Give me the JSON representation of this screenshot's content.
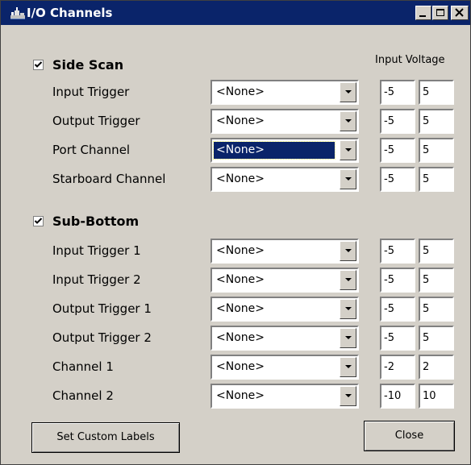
{
  "window": {
    "title": "I/O Channels",
    "controls": {
      "minimize": "minimize",
      "maximize": "maximize",
      "close": "close"
    }
  },
  "header": {
    "voltage_label": "Input Voltage"
  },
  "side_scan": {
    "label": "Side Scan",
    "checked": true,
    "rows": [
      {
        "label": "Input Trigger",
        "select": "<None>",
        "min": "-5",
        "max": "5",
        "selected": false
      },
      {
        "label": "Output Trigger",
        "select": "<None>",
        "min": "-5",
        "max": "5",
        "selected": false
      },
      {
        "label": "Port Channel",
        "select": "<None>",
        "min": "-5",
        "max": "5",
        "selected": true
      },
      {
        "label": "Starboard Channel",
        "select": "<None>",
        "min": "-5",
        "max": "5",
        "selected": false
      }
    ]
  },
  "sub_bottom": {
    "label": "Sub-Bottom",
    "checked": true,
    "rows": [
      {
        "label": "Input Trigger 1",
        "select": "<None>",
        "min": "-5",
        "max": "5",
        "selected": false
      },
      {
        "label": "Input Trigger 2",
        "select": "<None>",
        "min": "-5",
        "max": "5",
        "selected": false
      },
      {
        "label": "Output Trigger 1",
        "select": "<None>",
        "min": "-5",
        "max": "5",
        "selected": false
      },
      {
        "label": "Output Trigger 2",
        "select": "<None>",
        "min": "-5",
        "max": "5",
        "selected": false
      },
      {
        "label": "Channel 1",
        "select": "<None>",
        "min": "-2",
        "max": "2",
        "selected": false
      },
      {
        "label": "Channel 2",
        "select": "<None>",
        "min": "-10",
        "max": "10",
        "selected": false
      }
    ]
  },
  "buttons": {
    "custom_labels": "Set Custom Labels",
    "close": "Close"
  },
  "colors": {
    "titlebar": "#0a246a",
    "face": "#d4d0c8",
    "selection": "#0a246a"
  },
  "icons": {
    "app": "ship-icon",
    "check": "check-icon",
    "dropdown": "chevron-down-icon"
  }
}
